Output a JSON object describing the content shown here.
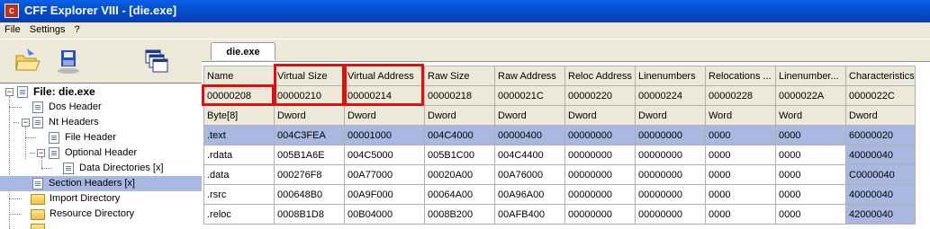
{
  "window": {
    "title": "CFF Explorer VIII - [die.exe]",
    "app_icon": "cff-icon"
  },
  "menu": [
    "File",
    "Settings",
    "?"
  ],
  "toolbar": [
    "open-file-icon",
    "save-disk-icon",
    "windows-icon"
  ],
  "tab": {
    "label": "die.exe"
  },
  "tree": {
    "root": "File: die.exe",
    "items": [
      {
        "label": "Dos Header"
      },
      {
        "label": "Nt Headers"
      },
      {
        "label": "File Header"
      },
      {
        "label": "Optional Header"
      },
      {
        "label": "Data Directories [x]"
      },
      {
        "label": "Section Headers [x]"
      },
      {
        "label": "Import Directory"
      },
      {
        "label": "Resource Directory"
      }
    ]
  },
  "grid": {
    "columns": [
      "Name",
      "Virtual Size",
      "Virtual Address",
      "Raw Size",
      "Raw Address",
      "Reloc Address",
      "Linenumbers",
      "Relocations ...",
      "Linenumber...",
      "Characteristics"
    ],
    "offsets": [
      "00000208",
      "00000210",
      "00000214",
      "00000218",
      "0000021C",
      "00000220",
      "00000224",
      "00000228",
      "0000022A",
      "0000022C"
    ],
    "types": [
      "Byte[8]",
      "Dword",
      "Dword",
      "Dword",
      "Dword",
      "Dword",
      "Dword",
      "Word",
      "Word",
      "Dword"
    ],
    "rows": [
      [
        ".text",
        "004C3FEA",
        "00001000",
        "004C4000",
        "00000400",
        "00000000",
        "00000000",
        "0000",
        "0000",
        "60000020"
      ],
      [
        ".rdata",
        "005B1A6E",
        "004C5000",
        "005B1C00",
        "004C4400",
        "00000000",
        "00000000",
        "0000",
        "0000",
        "40000040"
      ],
      [
        ".data",
        "000276F8",
        "00A77000",
        "00020A00",
        "00A76000",
        "00000000",
        "00000000",
        "0000",
        "0000",
        "C0000040"
      ],
      [
        ".rsrc",
        "000648B0",
        "00A9F000",
        "00064A00",
        "00A96A00",
        "00000000",
        "00000000",
        "0000",
        "0000",
        "40000040"
      ],
      [
        ".reloc",
        "0008B1D8",
        "00B04000",
        "0008B200",
        "00AFB400",
        "00000000",
        "00000000",
        "0000",
        "0000",
        "42000040"
      ]
    ]
  },
  "colors": {
    "highlight": "#e01010",
    "selection": "#a8b8e0",
    "titlebar": "#0a5fe8"
  }
}
